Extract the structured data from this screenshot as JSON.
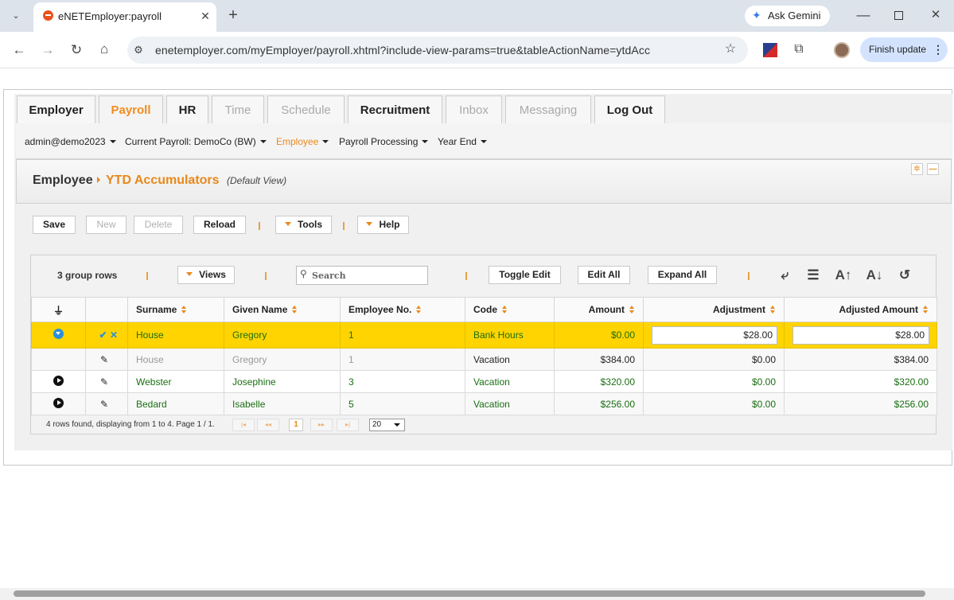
{
  "browser": {
    "tab_title": "eNETEmployer:payroll",
    "url": "enetemployer.com/myEmployer/payroll.xhtml?include-view-params=true&tableActionName=ytdAcc",
    "gemini_label": "Ask Gemini",
    "finish_update_label": "Finish update"
  },
  "main_tabs": [
    "Employer",
    "Payroll",
    "HR",
    "Time",
    "Schedule",
    "Recruitment",
    "Inbox",
    "Messaging",
    "Log Out"
  ],
  "sub_nav": {
    "user": "admin@demo2023",
    "current_payroll": "Current Payroll: DemoCo (BW)",
    "employee": "Employee",
    "payroll_processing": "Payroll Processing",
    "year_end": "Year End"
  },
  "breadcrumb": {
    "parent": "Employee",
    "current": "YTD Accumulators",
    "view": "(Default View)"
  },
  "actions": {
    "save": "Save",
    "new": "New",
    "delete": "Delete",
    "reload": "Reload",
    "tools": "Tools",
    "help": "Help"
  },
  "grid_toolbar": {
    "group_rows": "3 group rows",
    "views": "Views",
    "search_placeholder": "Search",
    "toggle_edit": "Toggle Edit",
    "edit_all": "Edit All",
    "expand_all": "Expand All"
  },
  "table": {
    "columns": [
      "Surname",
      "Given Name",
      "Employee No.",
      "Code",
      "Amount",
      "Adjustment",
      "Adjusted Amount"
    ],
    "rows": [
      {
        "surname": "House",
        "given": "Gregory",
        "emp_no": "1",
        "code": "Bank Hours",
        "amount": "$0.00",
        "adjustment": "$28.00",
        "adjusted": "$28.00"
      },
      {
        "surname": "House",
        "given": "Gregory",
        "emp_no": "1",
        "code": "Vacation",
        "amount": "$384.00",
        "adjustment": "$0.00",
        "adjusted": "$384.00"
      },
      {
        "surname": "Webster",
        "given": "Josephine",
        "emp_no": "3",
        "code": "Vacation",
        "amount": "$320.00",
        "adjustment": "$0.00",
        "adjusted": "$320.00"
      },
      {
        "surname": "Bedard",
        "given": "Isabelle",
        "emp_no": "5",
        "code": "Vacation",
        "amount": "$256.00",
        "adjustment": "$0.00",
        "adjusted": "$256.00"
      }
    ]
  },
  "pager": {
    "summary": "4 rows found, displaying from 1 to 4. Page 1 / 1.",
    "current_page": "1",
    "page_size": "20"
  },
  "colors": {
    "accent": "#e8891a",
    "selected_row": "#ffd400",
    "data_text": "#1a6e12"
  }
}
